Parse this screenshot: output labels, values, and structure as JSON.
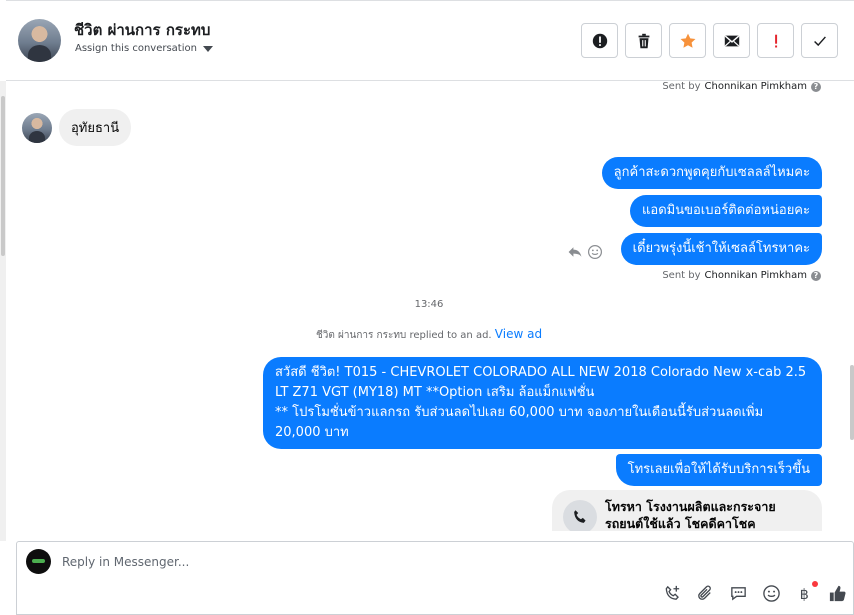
{
  "header": {
    "contact_name": "ชีวิต ผ่านการ กระทบ",
    "assign_label": "Assign this conversation",
    "toolbar": [
      {
        "name": "mark-spam-button",
        "icon": "alert-circle-icon"
      },
      {
        "name": "delete-button",
        "icon": "trash-icon"
      },
      {
        "name": "star-button",
        "icon": "star-icon"
      },
      {
        "name": "mark-unread-button",
        "icon": "envelope-icon"
      },
      {
        "name": "follow-up-button",
        "icon": "exclamation-icon"
      },
      {
        "name": "mark-done-button",
        "icon": "check-icon"
      }
    ]
  },
  "thread": {
    "sent_by_label": "Sent by",
    "agent_name": "Chonnikan Pimkham",
    "incoming_message": "อุทัยธานี",
    "outgoing_group_1": [
      "ลูกค้าสะดวกพูดคุยกับเซลลล์ไหมคะ",
      "แอดมินขอเบอร์ติดต่อหน่อยคะ",
      "เดี๋ยวพรุ่งนี้เช้าให้เซลล์โทรหาคะ"
    ],
    "timestamp": "13:46",
    "ad_note": "ชีวิต ผ่านการ กระทบ replied to an ad.",
    "ad_link": "View ad",
    "ad_message": "สวัสดี ชีวิต! T015 - CHEVROLET COLORADO ALL NEW 2018 Colorado New x-cab 2.5 LT Z71 VGT (MY18) MT **Option เสริม ล้อแม็กแฟชั่น\n** โปรโมชั่นข้าวแลกรถ รับส่วนลดไปเลย 60,000 บาท จองภายในเดือนนี้รับส่วนลดเพิ่ม 20,000 บาท",
    "followup_message": "โทรเลยเพื่อให้ได้รับบริการเร็วขึ้น",
    "call_card_text": "โทรหา โรงงานผลิตและกระจาย รถยนต์ใช้แล้ว โชคดีคาโชค"
  },
  "composer": {
    "placeholder": "Reply in Messenger...",
    "tools": [
      "add-contact-icon",
      "attachment-icon",
      "saved-reply-icon",
      "emoji-icon",
      "payment-icon",
      "like-icon"
    ]
  },
  "colors": {
    "accent": "#0a7cff",
    "star": "#f7923b",
    "follow_up": "#e4252d"
  }
}
